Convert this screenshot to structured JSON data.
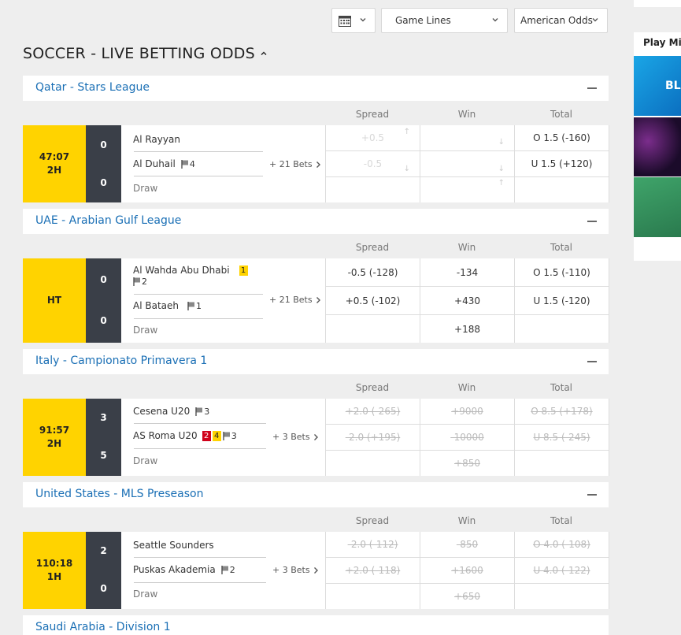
{
  "controls": {
    "calendar_icon": "calendar-icon",
    "game_lines": "Game Lines",
    "odds_format": "American Odds"
  },
  "page_title": "SOCCER - LIVE BETTING ODDS",
  "sidebar": {
    "title": "Play Mini",
    "thumb1_text": "BLA"
  },
  "columns": {
    "spread": "Spread",
    "win": "Win",
    "total": "Total"
  },
  "draw_label": "Draw",
  "leagues": [
    {
      "name": "Qatar - Stars League",
      "match": {
        "time": "47:07",
        "period": "2H",
        "home": {
          "name": "Al Rayyan",
          "score": "0"
        },
        "away": {
          "name": "Al Duhail",
          "score": "0",
          "corners": "4"
        },
        "bets": "+ 21 Bets",
        "spread": [
          "+0.5",
          "-0.5"
        ],
        "total": [
          "O 1.5 (-160)",
          "U 1.5 (+120)"
        ]
      }
    },
    {
      "name": "UAE - Arabian Gulf League",
      "match": {
        "time": "HT",
        "period": "",
        "home": {
          "name": "Al Wahda Abu Dhabi",
          "score": "0",
          "yellow": "1",
          "corners": "2"
        },
        "away": {
          "name": "Al Bataeh",
          "score": "0",
          "corners": "1"
        },
        "bets": "+ 21 Bets",
        "spread": [
          "-0.5 (-128)",
          "+0.5 (-102)"
        ],
        "win": [
          "-134",
          "+430",
          "+188"
        ],
        "total": [
          "O 1.5 (-110)",
          "U 1.5 (-120)"
        ]
      }
    },
    {
      "name": "Italy - Campionato Primavera 1",
      "match": {
        "time": "91:57",
        "period": "2H",
        "home": {
          "name": "Cesena U20",
          "score": "3",
          "corners": "3"
        },
        "away": {
          "name": "AS Roma U20",
          "score": "5",
          "red": "2",
          "yellow": "4",
          "corners": "3"
        },
        "bets": "+ 3 Bets",
        "spread": [
          "+2.0 (-265)",
          "-2.0 (+195)"
        ],
        "win": [
          "+9000",
          "-10000",
          "+850"
        ],
        "total": [
          "O 8.5 (+178)",
          "U 8.5 (-245)"
        ]
      }
    },
    {
      "name": "United States - MLS Preseason",
      "match": {
        "time": "110:18",
        "period": "1H",
        "home": {
          "name": "Seattle Sounders",
          "score": "2"
        },
        "away": {
          "name": "Puskas Akademia",
          "score": "0",
          "corners": "2"
        },
        "bets": "+ 3 Bets",
        "spread": [
          "-2.0 (-112)",
          "+2.0 (-118)"
        ],
        "win": [
          "-850",
          "+1600",
          "+650"
        ],
        "total": [
          "O 4.0 (-108)",
          "U 4.0 (-122)"
        ]
      }
    },
    {
      "name": "Saudi Arabia - Division 1"
    }
  ],
  "colors": {
    "accent_yellow": "#ffd300",
    "link_blue": "#1a6fb5",
    "score_bg": "#3a3f48",
    "card_red": "#d0021b"
  }
}
